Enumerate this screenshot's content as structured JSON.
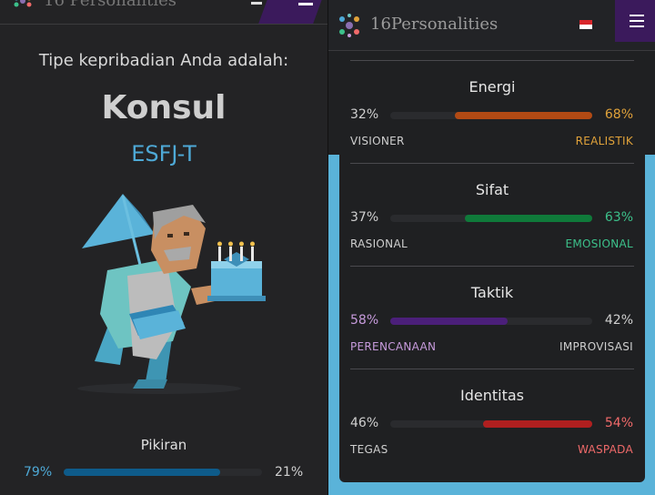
{
  "left": {
    "header": {
      "brand": "16 Personalities"
    },
    "subtitle": "Tipe kepribadian Anda adalah:",
    "type_name": "Konsul",
    "type_code": "ESFJ-T",
    "trait": {
      "name": "Pikiran",
      "left_pct": "79%",
      "right_pct": "21%",
      "fill": 0.79,
      "color": "#0e5b8a"
    }
  },
  "right": {
    "header": {
      "brand": "16Personalities"
    },
    "traits": [
      {
        "name": "Energi",
        "left_pct": "32%",
        "right_pct": "68%",
        "left_label": "VISIONER",
        "right_label": "REALISTIK",
        "fill_side": "right",
        "fill": 0.68,
        "color": "#b24a14",
        "left_color": "#cfcfcf",
        "right_color": "#e0a23a"
      },
      {
        "name": "Sifat",
        "left_pct": "37%",
        "right_pct": "63%",
        "left_label": "RASIONAL",
        "right_label": "EMOSIONAL",
        "fill_side": "right",
        "fill": 0.63,
        "color": "#0f7a3a",
        "left_color": "#cfcfcf",
        "right_color": "#3cc08a"
      },
      {
        "name": "Taktik",
        "left_pct": "58%",
        "right_pct": "42%",
        "left_label": "PERENCANAAN",
        "right_label": "IMPROVISASI",
        "fill_side": "left",
        "fill": 0.58,
        "color": "#4b1f7a",
        "left_color": "#c79bdc",
        "right_color": "#cfcfcf"
      },
      {
        "name": "Identitas",
        "left_pct": "46%",
        "right_pct": "54%",
        "left_label": "TEGAS",
        "right_label": "WASPADA",
        "fill_side": "right",
        "fill": 0.54,
        "color": "#b01f1f",
        "left_color": "#cfcfcf",
        "right_color": "#f06a6a"
      }
    ]
  }
}
